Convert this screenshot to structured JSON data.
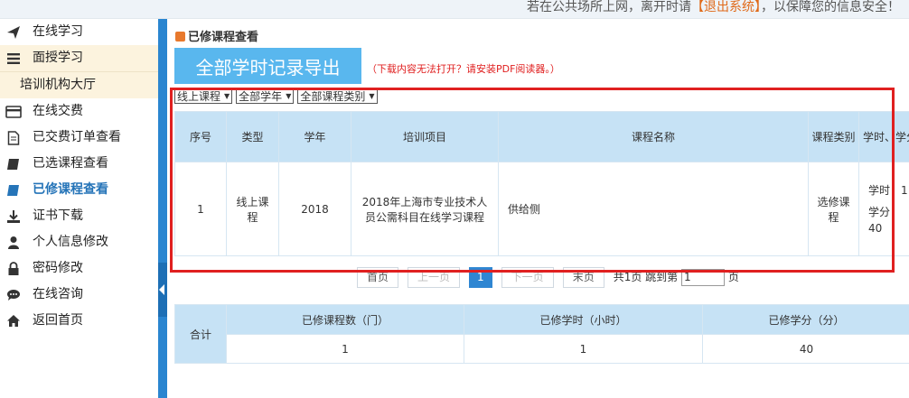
{
  "topbar": {
    "notice_prefix": "若在公共场所上网，离开时请",
    "logout_label": "【退出系统】",
    "notice_suffix": "，以保障您的信息安全！"
  },
  "sidebar": {
    "items": [
      {
        "label": "在线学习",
        "icon": "paper-plane-icon"
      },
      {
        "label": "面授学习",
        "icon": "menu-icon"
      },
      {
        "label": "培训机构大厅",
        "icon": ""
      },
      {
        "label": "在线交费",
        "icon": "card-icon"
      },
      {
        "label": "已交费订单查看",
        "icon": "document-icon"
      },
      {
        "label": "已选课程查看",
        "icon": "book-icon"
      },
      {
        "label": "已修课程查看",
        "icon": "book-icon"
      },
      {
        "label": "证书下载",
        "icon": "download-icon"
      },
      {
        "label": "个人信息修改",
        "icon": "user-icon"
      },
      {
        "label": "密码修改",
        "icon": "lock-icon"
      },
      {
        "label": "在线咨询",
        "icon": "chat-icon"
      },
      {
        "label": "返回首页",
        "icon": "home-icon"
      }
    ]
  },
  "main": {
    "title": "已修课程查看",
    "export_label": "全部学时记录导出",
    "pdf_note": "（下载内容无法打开？请安装PDF阅读器。）",
    "filters": [
      "线上课程",
      "全部学年",
      "全部课程类别"
    ],
    "table": {
      "headers": [
        "序号",
        "类型",
        "学年",
        "培训项目",
        "课程名称",
        "课程类别",
        "学时、学分"
      ],
      "rows": [
        {
          "no": "1",
          "type": "线上课程",
          "year": "2018",
          "project": "2018年上海市专业技术人员公需科目在线学习课程",
          "course": "供给侧",
          "category": "选修课程",
          "hours": "学时：1",
          "credits": "学分：40"
        }
      ]
    },
    "pager": {
      "first": "首页",
      "prev": "上一页",
      "current": "1",
      "next": "下一页",
      "last": "末页",
      "total": "共1页",
      "goto": "跳到第",
      "page_value": "1",
      "page_unit": "页"
    },
    "summary": {
      "total_label": "合计",
      "headers": [
        "已修课程数（门）",
        "已修学时（小时）",
        "已修学分（分）"
      ],
      "values": [
        "1",
        "1",
        "40"
      ]
    }
  },
  "colors": {
    "accent": "#2a85d0",
    "highlight": "#e02020",
    "header_bg": "#c6e2f5"
  }
}
